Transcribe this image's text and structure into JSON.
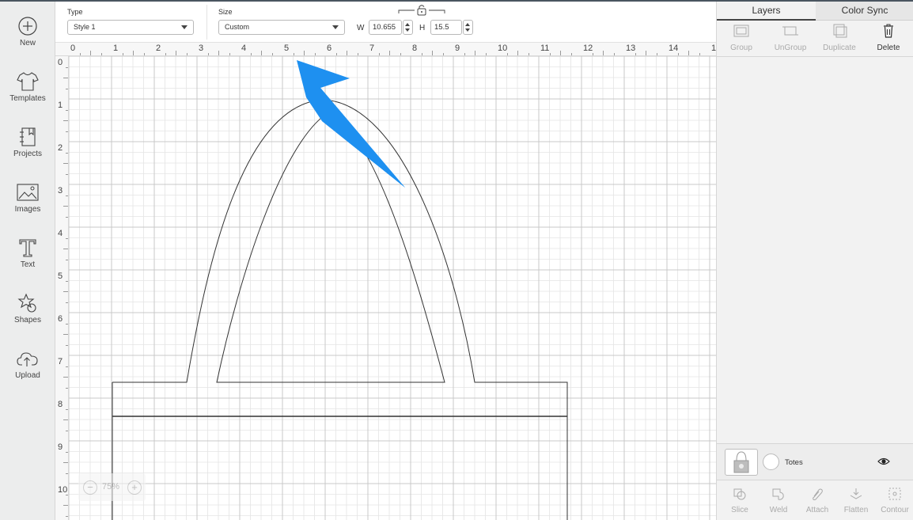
{
  "sidebar": {
    "items": [
      {
        "label": "New",
        "icon": "plus-circle-icon"
      },
      {
        "label": "Templates",
        "icon": "tshirt-icon"
      },
      {
        "label": "Projects",
        "icon": "notebook-icon"
      },
      {
        "label": "Images",
        "icon": "image-icon"
      },
      {
        "label": "Text",
        "icon": "text-icon"
      },
      {
        "label": "Shapes",
        "icon": "shapes-icon"
      },
      {
        "label": "Upload",
        "icon": "cloud-upload-icon"
      }
    ]
  },
  "toolbar": {
    "type_label": "Type",
    "type_value": "Style 1",
    "size_label": "Size",
    "size_value": "Custom",
    "w_label": "W",
    "w_value": "10.655",
    "h_label": "H",
    "h_value": "15.5",
    "lock_icon": "lock-icon"
  },
  "canvas": {
    "ruler_x": [
      "0",
      "1",
      "2",
      "3",
      "4",
      "5",
      "6",
      "7",
      "8",
      "9",
      "10",
      "11",
      "12",
      "13",
      "14",
      "1"
    ],
    "ruler_y": [
      "0",
      "1",
      "2",
      "3",
      "4",
      "5",
      "6",
      "7",
      "8",
      "9",
      "10"
    ],
    "zoom_value": "75%",
    "zoom_minus": "−",
    "zoom_plus": "+"
  },
  "panel": {
    "tabs": [
      {
        "label": "Layers",
        "active": true
      },
      {
        "label": "Color Sync",
        "active": false
      }
    ],
    "layer_tools": [
      {
        "label": "Group",
        "enabled": false
      },
      {
        "label": "UnGroup",
        "enabled": false
      },
      {
        "label": "Duplicate",
        "enabled": false
      },
      {
        "label": "Delete",
        "enabled": true
      }
    ],
    "layer": {
      "name": "Totes"
    },
    "bottom_tools": [
      "Slice",
      "Weld",
      "Attach",
      "Flatten",
      "Contour"
    ]
  },
  "colors": {
    "arrow": "#1e90f0",
    "grid_minor": "#e4e4e4",
    "grid_major": "#c8c8c8",
    "outline": "#333333"
  }
}
